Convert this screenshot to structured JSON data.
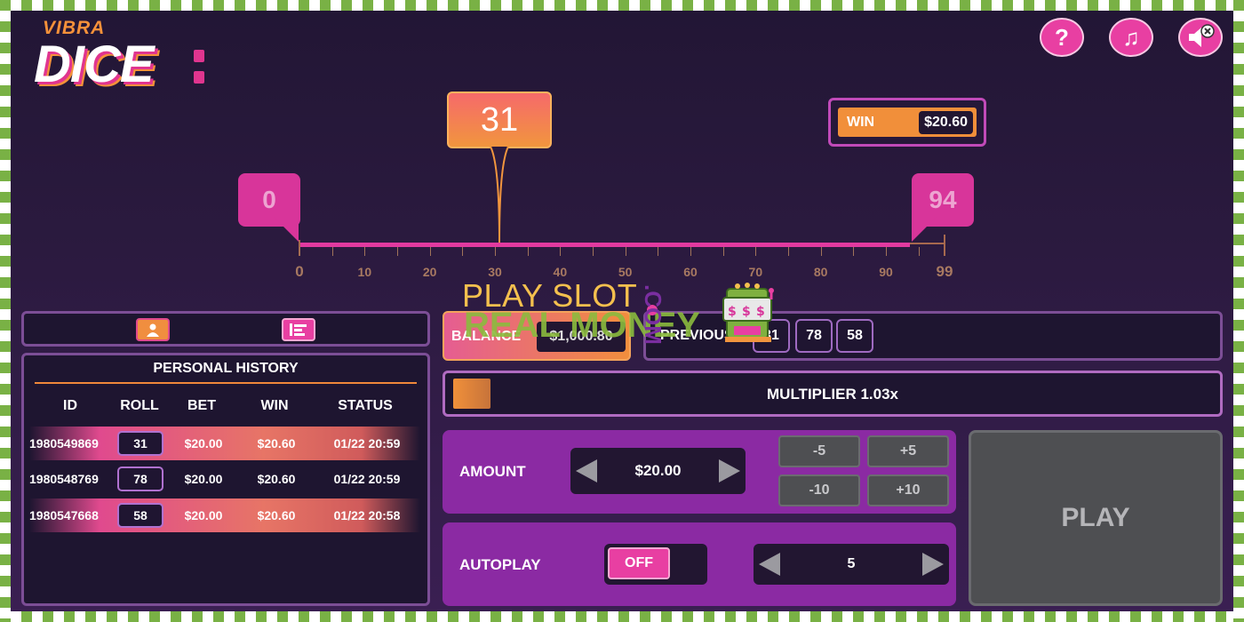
{
  "logo": {
    "top": "VIBRA",
    "main": "DICE"
  },
  "top_buttons": {
    "help": "?",
    "music": "♫",
    "sound": "mute"
  },
  "slider": {
    "roll_value": "31",
    "min_marker": "0",
    "max_marker": "94",
    "ticks": [
      "0",
      "10",
      "20",
      "30",
      "40",
      "50",
      "60",
      "70",
      "80",
      "90",
      "99"
    ]
  },
  "win": {
    "label": "WIN",
    "value": "$20.60"
  },
  "history": {
    "title": "PERSONAL HISTORY",
    "columns": [
      "ID",
      "ROLL",
      "BET",
      "WIN",
      "STATUS"
    ],
    "rows": [
      {
        "id": "1980549869",
        "roll": "31",
        "bet": "$20.00",
        "win": "$20.60",
        "status": "01/22 20:59",
        "highlight": true
      },
      {
        "id": "1980548769",
        "roll": "78",
        "bet": "$20.00",
        "win": "$20.60",
        "status": "01/22 20:59",
        "highlight": false
      },
      {
        "id": "1980547668",
        "roll": "58",
        "bet": "$20.00",
        "win": "$20.60",
        "status": "01/22 20:58",
        "highlight": true
      }
    ]
  },
  "balance": {
    "label": "BALANCE",
    "value": "$1,000.80"
  },
  "previous": {
    "label": "PREVIOUS",
    "values": [
      "31",
      "78",
      "58"
    ]
  },
  "multiplier": {
    "text": "MULTIPLIER 1.03x"
  },
  "amount": {
    "label": "AMOUNT",
    "value": "$20.00",
    "steps": [
      "-5",
      "+5",
      "-10",
      "+10"
    ]
  },
  "autoplay": {
    "label": "AUTOPLAY",
    "toggle": "OFF",
    "count": "5"
  },
  "play": {
    "label": "PLAY"
  },
  "watermark": {
    "line1": "PLAY SLOT",
    "line2": "REAL MONEY",
    "com": ".COM"
  },
  "colors": {
    "accent_pink": "#e83fa2",
    "accent_orange": "#f18f3a",
    "panel_purple": "#8b2aa3"
  }
}
